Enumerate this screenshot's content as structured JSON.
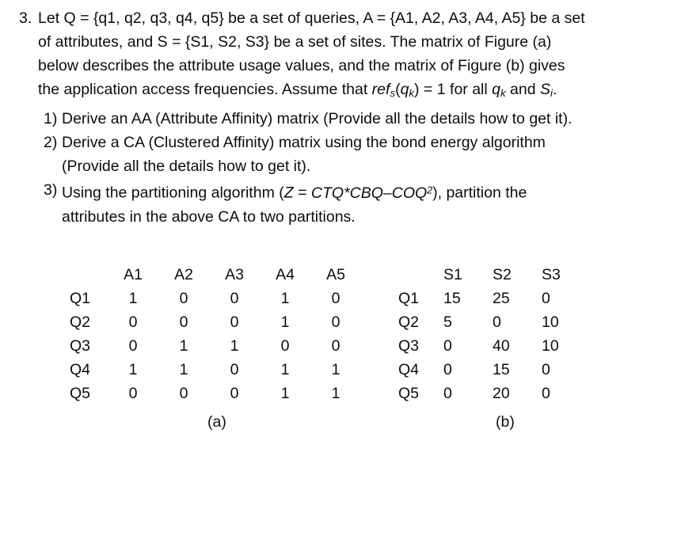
{
  "question": {
    "number": "3.",
    "lines": [
      "Let Q = {q1, q2, q3, q4, q5} be a set of queries, A = {A1, A2, A3, A4, A5} be a set",
      "of attributes, and S = {S1, S2, S3} be a set of sites. The matrix of Figure (a)",
      "below describes the attribute usage values, and the matrix of Figure (b) gives"
    ],
    "last_line": {
      "before": "the application access frequencies.  Assume that ",
      "math_ref": "ref",
      "math_ref_sub": "s",
      "math_qk_open": "(",
      "math_qk": "q",
      "math_qk_sub": "k",
      "math_qk_close": ")",
      "middle": " = 1 for all ",
      "math_qk2": "q",
      "math_qk2_sub": "k",
      "and": "  and ",
      "math_si": "S",
      "math_si_sub": "i",
      "period": "."
    }
  },
  "sublist": [
    {
      "marker": "1)",
      "lines": [],
      "last_line": "Derive an AA (Attribute Affinity) matrix (Provide all the details how to get it)."
    },
    {
      "marker": "2)",
      "lines": [
        "Derive a CA (Clustered Affinity) matrix using the bond energy algorithm"
      ],
      "last_line": "(Provide all the details how to get it)."
    },
    {
      "marker": "3)",
      "lines": [],
      "formula_line": {
        "before": "Using the partitioning algorithm (",
        "z": "Z",
        "eq": " = ",
        "expr": "CTQ*CBQ–COQ",
        "sup": "2",
        "after": "), partition the"
      },
      "last_line": "attributes in the above CA to two partitions."
    }
  ],
  "matrix_a": {
    "caption": "(a)",
    "corner": "",
    "columns": [
      "A1",
      "A2",
      "A3",
      "A4",
      "A5"
    ],
    "rows": [
      {
        "label": "Q1",
        "values": [
          "1",
          "0",
          "0",
          "1",
          "0"
        ]
      },
      {
        "label": "Q2",
        "values": [
          "0",
          "0",
          "0",
          "1",
          "0"
        ]
      },
      {
        "label": "Q3",
        "values": [
          "0",
          "1",
          "1",
          "0",
          "0"
        ]
      },
      {
        "label": "Q4",
        "values": [
          "1",
          "1",
          "0",
          "1",
          "1"
        ]
      },
      {
        "label": "Q5",
        "values": [
          "0",
          "0",
          "0",
          "1",
          "1"
        ]
      }
    ]
  },
  "matrix_b": {
    "caption": "(b)",
    "corner": "",
    "columns": [
      "S1",
      "S2",
      "S3"
    ],
    "rows": [
      {
        "label": "Q1",
        "values": [
          "15",
          "25",
          "0"
        ]
      },
      {
        "label": "Q2",
        "values": [
          "5",
          "0",
          "10"
        ]
      },
      {
        "label": "Q3",
        "values": [
          "0",
          "40",
          "10"
        ]
      },
      {
        "label": "Q4",
        "values": [
          "0",
          "15",
          "0"
        ]
      },
      {
        "label": "Q5",
        "values": [
          "0",
          "20",
          "0"
        ]
      }
    ]
  }
}
